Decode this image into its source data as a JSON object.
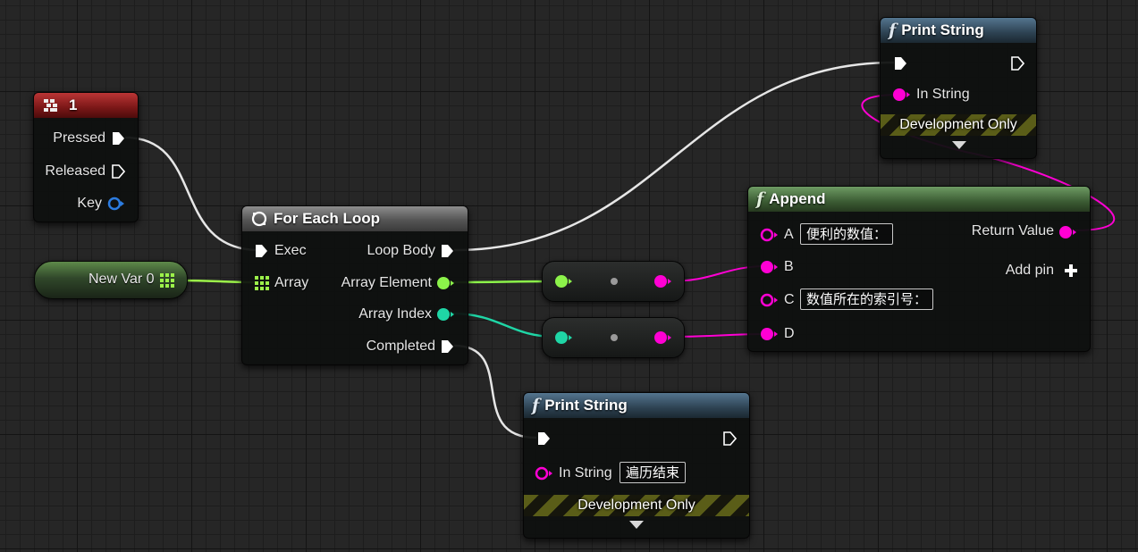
{
  "colors": {
    "exec": "#ffffff",
    "string_pin": "#ff00d4",
    "int_pin": "#1fd6a6",
    "wildcard_pin": "#8cf34a",
    "array_pin": "#9cf24a",
    "key_pin": "#2c7ce0",
    "header_function": "#3e5a6e",
    "header_append": "#507a48",
    "header_macro": "#6e6e6e",
    "header_event": "#9a2222"
  },
  "key_event_node": {
    "title": "1",
    "title_icon": "key-event-icon",
    "outputs": [
      "Pressed",
      "Released",
      "Key"
    ]
  },
  "variable_node": {
    "label": "New Var 0",
    "icon": "array-grid-icon"
  },
  "for_each_loop": {
    "title": "For Each Loop",
    "title_icon": "loop-icon",
    "inputs": [
      "Exec",
      "Array"
    ],
    "outputs": [
      "Loop Body",
      "Array Element",
      "Array Index",
      "Completed"
    ]
  },
  "print_string_top": {
    "title": "Print String",
    "in_string_label": "In String",
    "dev_only_label": "Development Only"
  },
  "append": {
    "title": "Append",
    "pins": [
      {
        "name": "A",
        "value": "便利的数值："
      },
      {
        "name": "B",
        "value": ""
      },
      {
        "name": "C",
        "value": "数值所在的索引号："
      },
      {
        "name": "D",
        "value": ""
      }
    ],
    "return_label": "Return Value",
    "add_pin_label": "Add pin"
  },
  "print_string_bottom": {
    "title": "Print String",
    "in_string_label": "In String",
    "in_string_value": "遍历结束",
    "dev_only_label": "Development Only"
  }
}
